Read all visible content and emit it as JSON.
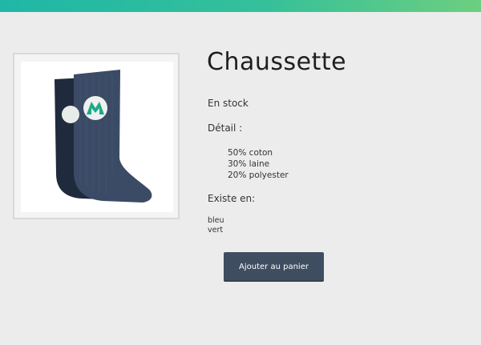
{
  "colors": {
    "accent_start": "#1fb7a6",
    "accent_end": "#6ccf7f",
    "button_bg": "#3f4d61",
    "background": "#ececec"
  },
  "product": {
    "image_icon": "sock-product-image",
    "title": "Chaussette",
    "stock_status": "En stock",
    "details_label": "Détail :",
    "details": [
      "50% coton",
      "30% laine",
      "20% polyester"
    ],
    "variants_label": "Existe en:",
    "variants": [
      "bleu",
      "vert"
    ],
    "add_to_cart_label": "Ajouter au panier"
  }
}
